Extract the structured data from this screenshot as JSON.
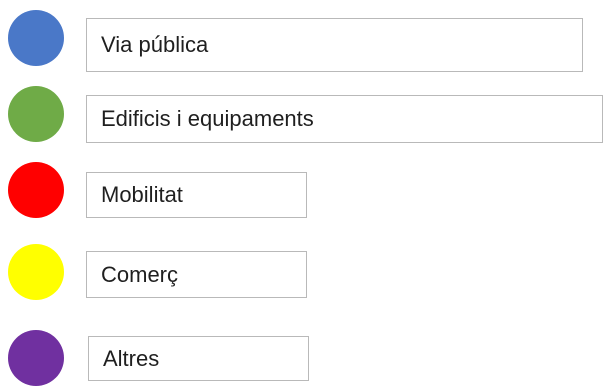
{
  "legend": {
    "items": [
      {
        "label": "Via pública",
        "color": "#4a78c8"
      },
      {
        "label": "Edificis i equipaments",
        "color": "#6fab47"
      },
      {
        "label": "Mobilitat",
        "color": "#ff0000"
      },
      {
        "label": "Comerç",
        "color": "#ffff00"
      },
      {
        "label": "Altres",
        "color": "#7030a0"
      }
    ]
  }
}
